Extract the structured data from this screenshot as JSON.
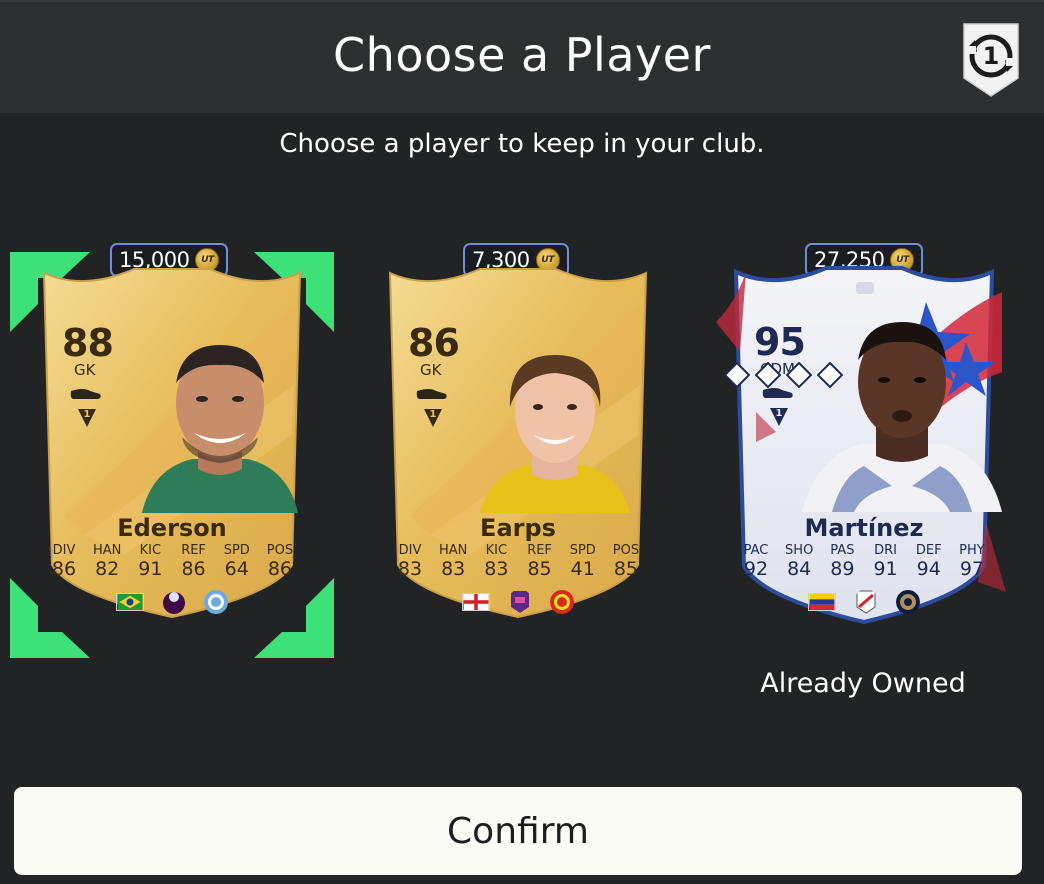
{
  "header": {
    "title": "Choose a Player"
  },
  "subtitle": "Choose a player to keep in your club.",
  "cards": [
    {
      "price": "15,000",
      "coin_label": "UT",
      "rating": "88",
      "position": "GK",
      "name": "Ederson",
      "skill_level": "1",
      "selected": true,
      "stats": [
        {
          "label": "DIV",
          "value": "86"
        },
        {
          "label": "HAN",
          "value": "82"
        },
        {
          "label": "KIC",
          "value": "91"
        },
        {
          "label": "REF",
          "value": "86"
        },
        {
          "label": "SPD",
          "value": "64"
        },
        {
          "label": "POS",
          "value": "86"
        }
      ],
      "badges": [
        "brazil-flag",
        "premier-league-crest",
        "manchester-city-crest"
      ]
    },
    {
      "price": "7,300",
      "coin_label": "UT",
      "rating": "86",
      "position": "GK",
      "name": "Earps",
      "skill_level": "1",
      "selected": false,
      "stats": [
        {
          "label": "DIV",
          "value": "83"
        },
        {
          "label": "HAN",
          "value": "83"
        },
        {
          "label": "KIC",
          "value": "83"
        },
        {
          "label": "REF",
          "value": "85"
        },
        {
          "label": "SPD",
          "value": "41"
        },
        {
          "label": "POS",
          "value": "85"
        }
      ],
      "badges": [
        "england-flag",
        "wsl-crest",
        "manchester-united-crest"
      ]
    },
    {
      "price": "27,250",
      "coin_label": "UT",
      "rating": "95",
      "position": "CDM",
      "name": "Martínez",
      "skill_level": "1",
      "selected": false,
      "stats": [
        {
          "label": "PAC",
          "value": "92"
        },
        {
          "label": "SHO",
          "value": "84"
        },
        {
          "label": "PAS",
          "value": "89"
        },
        {
          "label": "DRI",
          "value": "91"
        },
        {
          "label": "DEF",
          "value": "94"
        },
        {
          "label": "PHY",
          "value": "97"
        }
      ],
      "badges": [
        "venezuela-flag",
        "mls-crest",
        "philadelphia-union-crest"
      ],
      "status": "Already Owned"
    }
  ],
  "reset_badge": {
    "label": "1"
  },
  "confirm": {
    "label": "Confirm"
  },
  "colors": {
    "background": "#222325",
    "selection": "#3ee07a",
    "price_border": "#6f8fd6",
    "gold": "#e8c26a"
  }
}
